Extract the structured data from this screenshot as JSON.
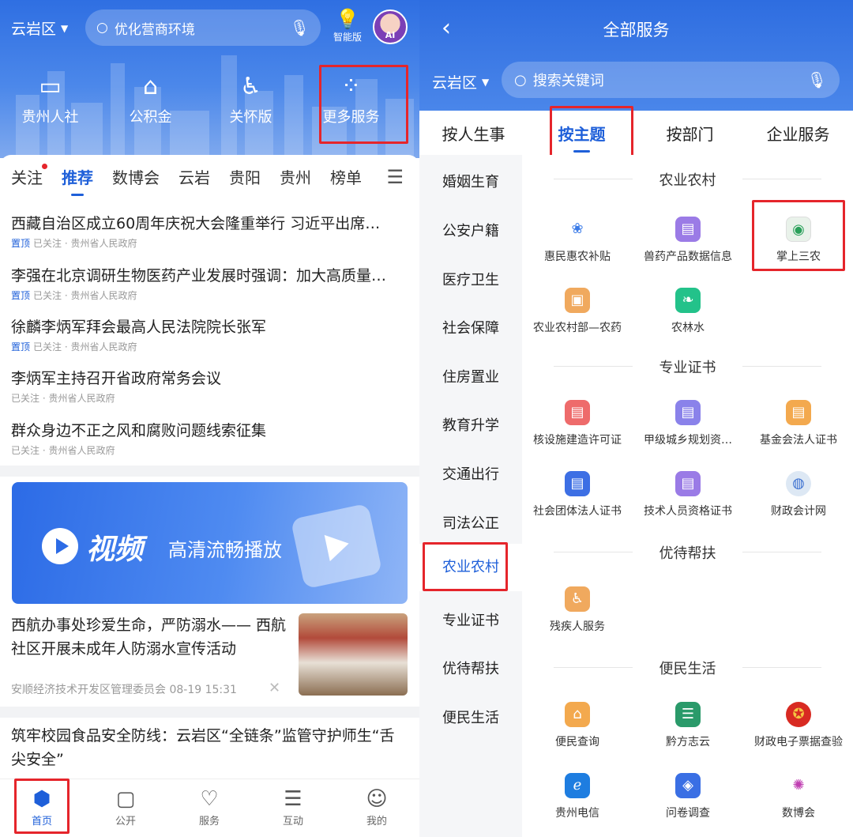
{
  "left": {
    "region": "云岩区",
    "search_placeholder": "优化营商环境",
    "smart_label": "智能版",
    "avatar_label": "AI",
    "shortcuts": [
      "贵州人社",
      "公积金",
      "关怀版",
      "更多服务"
    ],
    "tabs": [
      "关注",
      "推荐",
      "数博会",
      "云岩",
      "贵阳",
      "贵州",
      "榜单"
    ],
    "news": [
      {
        "title": "西藏自治区成立60周年庆祝大会隆重举行 习近平出席…",
        "pin": "置顶",
        "meta": "已关注 · 贵州省人民政府"
      },
      {
        "title": "李强在北京调研生物医药产业发展时强调：加大高质量…",
        "pin": "置顶",
        "meta": "已关注 · 贵州省人民政府"
      },
      {
        "title": "徐麟李炳军拜会最高人民法院院长张军",
        "pin": "置顶",
        "meta": "已关注 · 贵州省人民政府"
      },
      {
        "title": "李炳军主持召开省政府常务会议",
        "pin": "",
        "meta": "已关注 · 贵州省人民政府"
      },
      {
        "title": "群众身边不正之风和腐败问题线索征集",
        "pin": "",
        "meta": "已关注 · 贵州省人民政府"
      }
    ],
    "banner": {
      "word": "视频",
      "text": "高清流畅播放"
    },
    "article2": {
      "title": "西航办事处珍爱生命，严防溺水—— 西航社区开展未成年人防溺水宣传活动",
      "meta": "安顺经济技术开发区管理委员会  08-19 15:31"
    },
    "article3": {
      "title": "筑牢校园食品安全防线：云岩区“全链条”监管守护师生“舌尖安全”"
    },
    "nav": [
      "首页",
      "公开",
      "服务",
      "互动",
      "我的"
    ]
  },
  "right": {
    "title": "全部服务",
    "region": "云岩区",
    "search_placeholder": "搜索关键词",
    "tabs": [
      "按人生事",
      "按主题",
      "按部门",
      "企业服务"
    ],
    "sidebar": [
      "婚姻生育",
      "公安户籍",
      "医疗卫生",
      "社会保障",
      "住房置业",
      "教育升学",
      "交通出行",
      "司法公正",
      "农业农村",
      "专业证书",
      "优待帮扶",
      "便民生活"
    ],
    "sections": [
      {
        "title": "农业农村",
        "items": [
          "惠民惠农补贴",
          "兽药产品数据信息",
          "掌上三农",
          "农业农村部—农药",
          "农林水"
        ]
      },
      {
        "title": "专业证书",
        "items": [
          "核设施建造许可证",
          "甲级城乡规划资…",
          "基金会法人证书",
          "社会团体法人证书",
          "技术人员资格证书",
          "财政会计网"
        ]
      },
      {
        "title": "优待帮扶",
        "items": [
          "残疾人服务"
        ]
      },
      {
        "title": "便民生活",
        "items": [
          "便民查询",
          "黔方志云",
          "财政电子票据查验",
          "贵州电信",
          "问卷调查",
          "数博会"
        ]
      }
    ]
  },
  "colors": {
    "primary": "#1e5fd9",
    "highlight": "#e5252b"
  }
}
